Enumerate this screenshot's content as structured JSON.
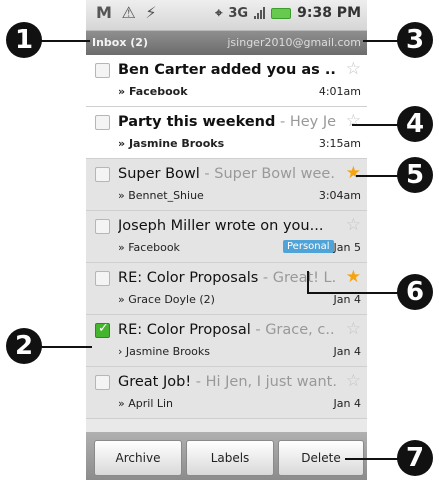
{
  "status_bar": {
    "left_icons": "M ⚠ ⚡",
    "network": "3G",
    "time": "9:38 PM"
  },
  "inbox_bar": {
    "title": "Inbox (2)",
    "account": "jsinger2010@gmail.com"
  },
  "emails": [
    {
      "subject": "Ben Carter added you as ...",
      "snippet": "",
      "sender": "Facebook",
      "date": "4:01am",
      "unread": true,
      "starred": false,
      "checked": false
    },
    {
      "subject": "Party this weekend",
      "snippet": " - Hey Je...",
      "sender": "Jasmine Brooks",
      "date": "3:15am",
      "unread": true,
      "starred": false,
      "checked": false
    },
    {
      "subject": "Super Bowl",
      "snippet": " - Super Bowl wee...",
      "sender": "Bennet_Shiue",
      "date": "3:04am",
      "unread": false,
      "starred": true,
      "checked": false
    },
    {
      "subject": "Joseph Miller wrote on you...",
      "snippet": "",
      "sender": "Facebook",
      "date": "Jan 5",
      "unread": false,
      "starred": false,
      "checked": false,
      "label": "Personal"
    },
    {
      "subject": "RE: Color Proposals",
      "snippet": " - Great! L...",
      "sender": "Grace Doyle (2)",
      "date": "Jan 4",
      "unread": false,
      "starred": true,
      "checked": false
    },
    {
      "subject": "RE: Color Proposal",
      "snippet": " - Grace, c...",
      "sender": "Jasmine Brooks",
      "date": "Jan 4",
      "unread": false,
      "starred": false,
      "checked": true
    },
    {
      "subject": "Great Job!",
      "snippet": " - Hi Jen, I just want...",
      "sender": "April Lin",
      "date": "Jan 4",
      "unread": false,
      "starred": false,
      "checked": false
    }
  ],
  "actions": {
    "archive": "Archive",
    "labels": "Labels",
    "delete": "Delete"
  },
  "callouts": [
    "1",
    "2",
    "3",
    "4",
    "5",
    "6",
    "7"
  ],
  "colors": {
    "star_on": "#f4a412",
    "checkbox_checked": "#46b52e",
    "label_personal": "#4fa3d6"
  }
}
